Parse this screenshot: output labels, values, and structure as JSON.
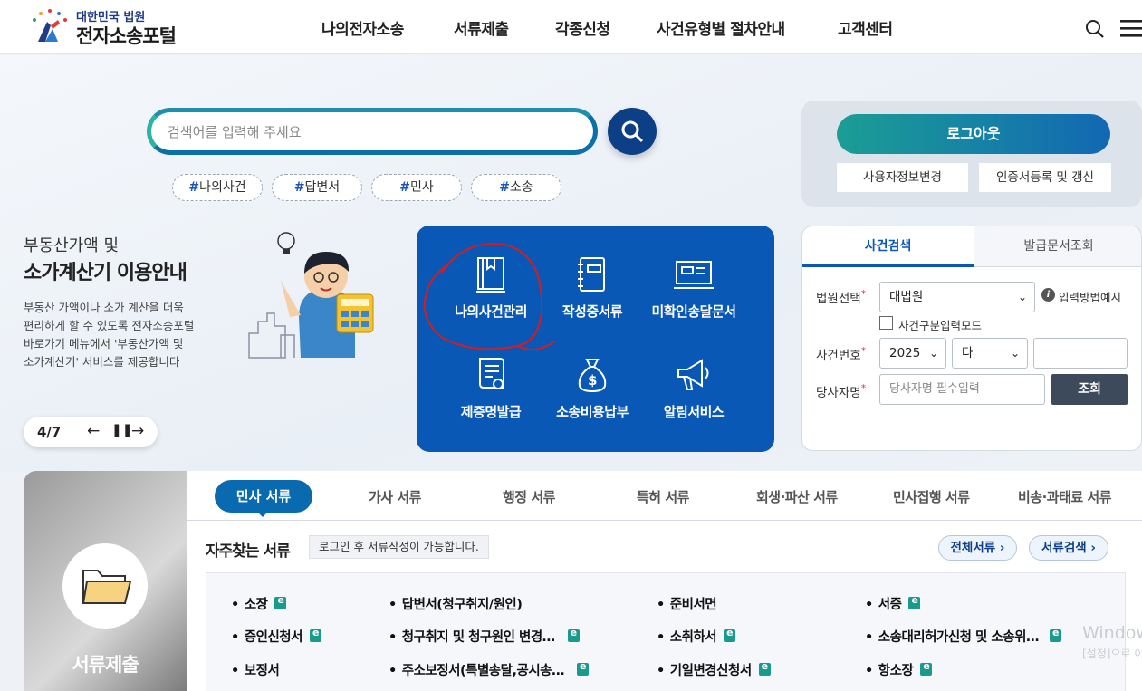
{
  "header": {
    "logo_sub": "대한민국 법원",
    "logo_main": "전자소송포털",
    "nav": [
      "나의전자소송",
      "서류제출",
      "각종신청",
      "사건유형별 절차안내",
      "고객센터"
    ]
  },
  "search": {
    "placeholder": "검색어를 입력해 주세요",
    "tags": [
      "나의사건",
      "답변서",
      "민사",
      "소송"
    ]
  },
  "promo": {
    "title_line1": "부동산가액 및",
    "title_line2": "소가계산기 이용안내",
    "description": "부동산 가액이나 소가 계산을 더욱 편리하게 할 수 있도록 전자소송포털 바로가기 메뉴에서 '부동산가액 및 소가계산기' 서비스를 제공합니다",
    "pager": "4/7"
  },
  "quick_menu": [
    {
      "label": "나의사건관리",
      "icon": "book-icon"
    },
    {
      "label": "작성중서류",
      "icon": "notebook-icon"
    },
    {
      "label": "미확인송달문서",
      "icon": "monitor-icon"
    },
    {
      "label": "제증명발급",
      "icon": "certificate-icon"
    },
    {
      "label": "소송비용납부",
      "icon": "money-bag-icon"
    },
    {
      "label": "알림서비스",
      "icon": "megaphone-icon"
    }
  ],
  "account": {
    "logout": "로그아웃",
    "edit_profile": "사용자정보변경",
    "cert": "인증서등록 및 갱신"
  },
  "case_search": {
    "tabs": [
      "사건검색",
      "발급문서조회"
    ],
    "court_label": "법원선택",
    "court_value": "대법원",
    "input_example": "입력방법예시",
    "case_type_mode": "사건구분입력모드",
    "case_no_label": "사건번호",
    "year_value": "2025",
    "type_value": "다",
    "party_label": "당사자명",
    "party_placeholder": "당사자명 필수입력",
    "search_btn": "조회"
  },
  "documents": {
    "side_title": "서류제출",
    "tabs": [
      "민사 서류",
      "가사 서류",
      "행정 서류",
      "특허 서류",
      "회생·파산 서류",
      "민사집행 서류",
      "비송·과태료 서류"
    ],
    "heading": "자주찾는 서류",
    "notice": "로그인 후 서류작성이 가능합니다.",
    "all_docs": "전체서류",
    "doc_search": "서류검색",
    "items": [
      "소장",
      "답변서(청구취지/원인)",
      "준비서면",
      "서증",
      "증인신청서",
      "청구취지 및 청구원인 변경…",
      "소취하서",
      "소송대리허가신청 및 소송위…",
      "보정서",
      "주소보정서(특별송달,공시송…",
      "기일변경신청서",
      "항소장"
    ]
  },
  "watermark": {
    "line1": "Windows 정품 인증",
    "line2": "[설정]으로 이동하여 Windows를 정품 인증합니다."
  },
  "colors": {
    "primary": "#0a58b6",
    "navy": "#0d3f86",
    "teal": "#1b9e95"
  }
}
